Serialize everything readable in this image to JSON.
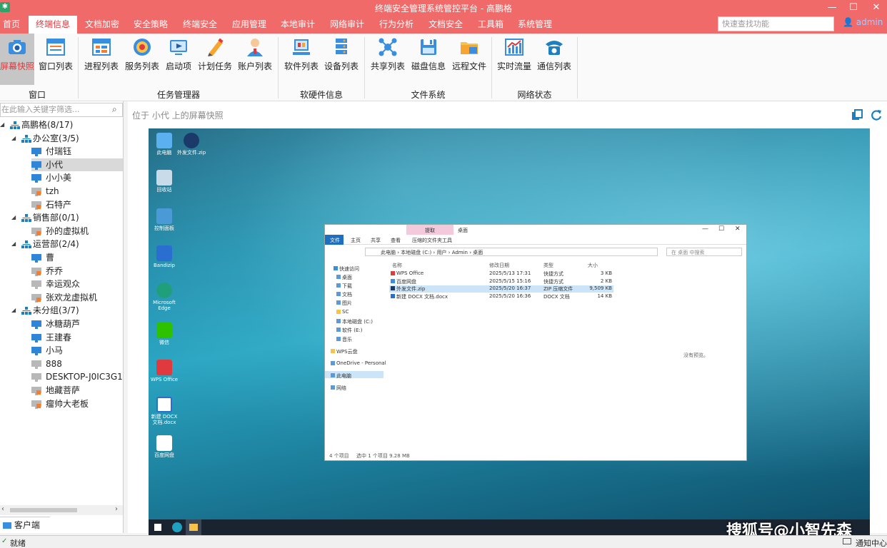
{
  "window": {
    "title": "终端安全管理系统管控平台 - 高鹏格"
  },
  "menu": {
    "items": [
      "首页",
      "终端信息",
      "文档加密",
      "安全策略",
      "终端安全",
      "应用管理",
      "本地审计",
      "网络审计",
      "行为分析",
      "文档安全",
      "工具箱",
      "系统管理"
    ],
    "active_index": 1,
    "search_placeholder": "快速查找功能",
    "user": "admin"
  },
  "ribbon": {
    "buttons": [
      {
        "label": "屏幕快照",
        "icon": "camera-icon"
      },
      {
        "label": "窗口列表",
        "icon": "window-list-icon"
      },
      {
        "label": "进程列表",
        "icon": "process-list-icon"
      },
      {
        "label": "服务列表",
        "icon": "service-list-icon"
      },
      {
        "label": "启动项",
        "icon": "startup-icon"
      },
      {
        "label": "计划任务",
        "icon": "pencil-icon"
      },
      {
        "label": "账户列表",
        "icon": "user-account-icon"
      },
      {
        "label": "软件列表",
        "icon": "software-list-icon"
      },
      {
        "label": "设备列表",
        "icon": "device-list-icon"
      },
      {
        "label": "共享列表",
        "icon": "share-icon"
      },
      {
        "label": "磁盘信息",
        "icon": "disk-icon"
      },
      {
        "label": "远程文件",
        "icon": "remote-folder-icon"
      },
      {
        "label": "实时流量",
        "icon": "traffic-chart-icon"
      },
      {
        "label": "通信列表",
        "icon": "telephone-icon"
      }
    ],
    "groups": [
      "窗口",
      "任务管理器",
      "软硬件信息",
      "文件系统",
      "网络状态"
    ]
  },
  "tree": {
    "filter_placeholder": "在此输入关键字筛选...",
    "nodes": [
      {
        "label": "高鹏格(8/17)",
        "level": 0,
        "type": "org"
      },
      {
        "label": "办公室(3/5)",
        "level": 1,
        "type": "org"
      },
      {
        "label": "付瑞钰",
        "level": 2,
        "type": "online"
      },
      {
        "label": "小代",
        "level": 2,
        "type": "online",
        "selected": true
      },
      {
        "label": "小小美",
        "level": 2,
        "type": "online"
      },
      {
        "label": "tzh",
        "level": 2,
        "type": "locked"
      },
      {
        "label": "石特产",
        "level": 2,
        "type": "locked"
      },
      {
        "label": "销售部(0/1)",
        "level": 1,
        "type": "org"
      },
      {
        "label": "孙的虚拟机",
        "level": 2,
        "type": "locked"
      },
      {
        "label": "运营部(2/4)",
        "level": 1,
        "type": "org"
      },
      {
        "label": "曹",
        "level": 2,
        "type": "online"
      },
      {
        "label": "乔乔",
        "level": 2,
        "type": "locked"
      },
      {
        "label": "幸运观众",
        "level": 2,
        "type": "offline"
      },
      {
        "label": "张欢龙虚拟机",
        "level": 2,
        "type": "locked"
      },
      {
        "label": "未分组(3/7)",
        "level": 1,
        "type": "org"
      },
      {
        "label": "冰糖葫芦",
        "level": 2,
        "type": "online"
      },
      {
        "label": "王建春",
        "level": 2,
        "type": "online"
      },
      {
        "label": "小马",
        "level": 2,
        "type": "online"
      },
      {
        "label": "888",
        "level": 2,
        "type": "offline"
      },
      {
        "label": "DESKTOP-J0IC3G1",
        "level": 2,
        "type": "offline"
      },
      {
        "label": "地藏菩萨",
        "level": 2,
        "type": "locked"
      },
      {
        "label": "瘤帅大老板",
        "level": 2,
        "type": "locked"
      }
    ],
    "client_tab": "客户端"
  },
  "content": {
    "location": "位于 小代 上的屏幕快照"
  },
  "snapshot": {
    "desktop_icons": [
      "此电脑",
      "外发文件.zip",
      "回收站",
      "控制面板",
      "Bandizip",
      "Microsoft Edge",
      "微信",
      "WPS Office",
      "新建 DOCX 文档.docx",
      "百度网盘"
    ],
    "explorer": {
      "tab_extract": "提取",
      "tab_desktop": "桌面",
      "ribbon_tabs": [
        "文件",
        "主页",
        "共享",
        "查看",
        "压缩的文件夹工具"
      ],
      "path": [
        "此电脑",
        "本地磁盘 (C:)",
        "用户",
        "Admin",
        "桌面"
      ],
      "search": "在 桌面 中搜索",
      "columns": [
        "名称",
        "修改日期",
        "类型",
        "大小"
      ],
      "files": [
        {
          "name": "WPS Office",
          "date": "2025/5/13 17:31",
          "type": "快捷方式",
          "size": "3 KB"
        },
        {
          "name": "百度网盘",
          "date": "2025/5/15 15:16",
          "type": "快捷方式",
          "size": "2 KB"
        },
        {
          "name": "外发文件.zip",
          "date": "2025/5/20 16:37",
          "type": "ZIP 压缩文件",
          "size": "9,509 KB"
        },
        {
          "name": "新建 DOCX 文档.docx",
          "date": "2025/5/20 16:36",
          "type": "DOCX 文档",
          "size": "14 KB"
        }
      ],
      "nav": [
        "快速访问",
        "桌面",
        "下载",
        "文档",
        "图片",
        "SC",
        "本地磁盘 (C:)",
        "软件 (E:)",
        "音乐",
        "WPS云盘",
        "OneDrive - Personal",
        "此电脑",
        "网络"
      ],
      "preview": "没有预览。",
      "status_count": "4 个项目",
      "status_selected": "选中 1 个项目 9.28 MB"
    }
  },
  "statusbar": {
    "left": "就绪",
    "right": "通知中心"
  },
  "watermark": "搜狐号@小智先森"
}
